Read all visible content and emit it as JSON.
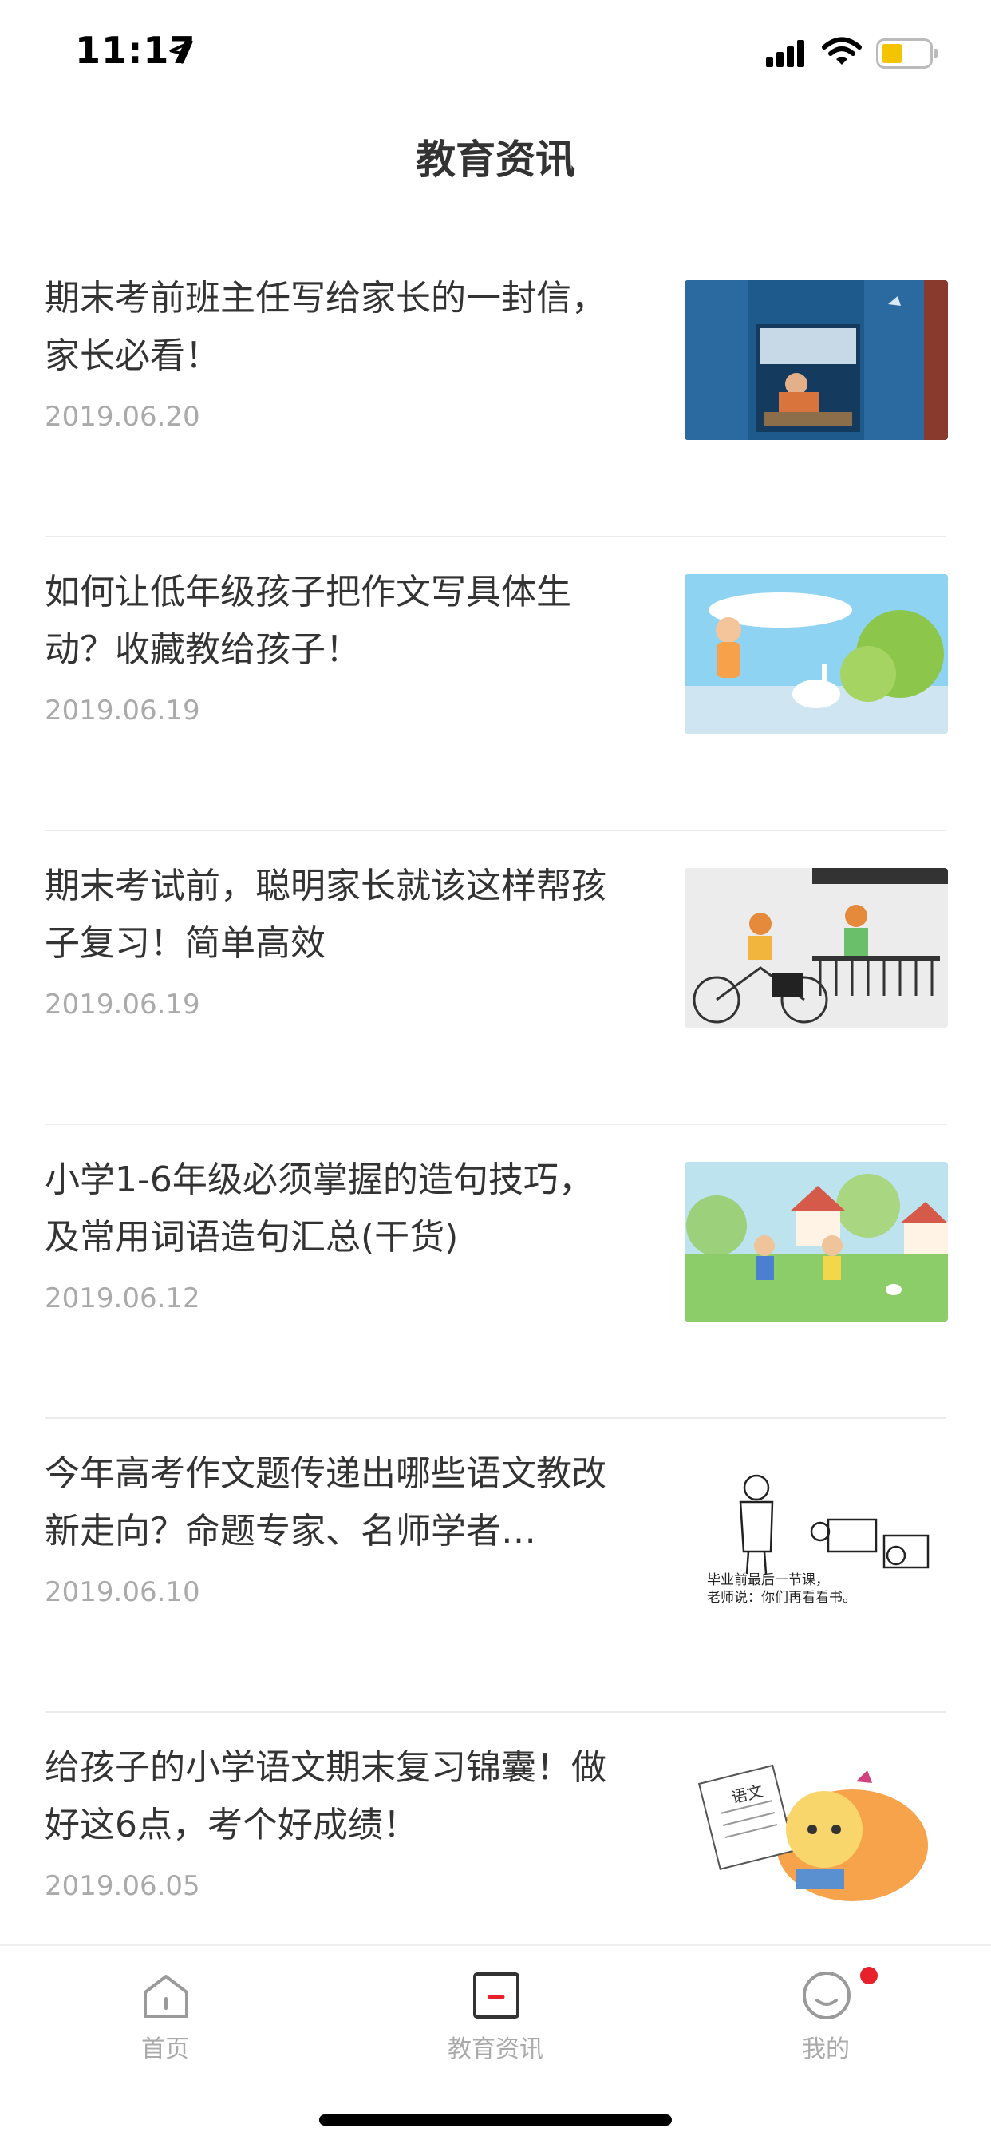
{
  "status_bar": {
    "time": "11:17",
    "icons": [
      "location-arrow-icon",
      "cellular-signal-icon",
      "wifi-icon",
      "battery-icon"
    ],
    "battery_color": "#f5c400"
  },
  "nav": {
    "title": "教育资讯"
  },
  "articles": [
    {
      "title": "期末考前班主任写给家长的一封信，家长必看！",
      "date": "2019.06.20",
      "thumbnail": "window-illustration"
    },
    {
      "title": "如何让低年级孩子把作文写具体生动？收藏教给孩子！",
      "date": "2019.06.19",
      "thumbnail": "girl-goose-illustration"
    },
    {
      "title": "期末考试前，聪明家长就该这样帮孩子复习！简单高效",
      "date": "2019.06.19",
      "thumbnail": "bicycle-boy-illustration"
    },
    {
      "title": "小学1-6年级必须掌握的造句技巧，及常用词语造句汇总(干货)",
      "date": "2019.06.12",
      "thumbnail": "children-playing-illustration"
    },
    {
      "title": "今年高考作文题传递出哪些语文教改新走向？命题专家、名师学者…",
      "date": "2019.06.10",
      "thumbnail": "teacher-sketch-illustration",
      "sketch_caption_1": "毕业前最后一节课，",
      "sketch_caption_2": "老师说：你们再看看书。"
    },
    {
      "title": "给孩子的小学语文期末复习锦囊！做好这6点，考个好成绩！",
      "date": "2019.06.05",
      "thumbnail": "girl-chinese-book-illustration",
      "book_label": "语文"
    }
  ],
  "tab_bar": {
    "tabs": [
      {
        "label": "首页",
        "icon": "home-icon",
        "active": false
      },
      {
        "label": "教育资讯",
        "icon": "news-icon",
        "active": true
      },
      {
        "label": "我的",
        "icon": "profile-smile-icon",
        "active": false,
        "has_badge": true
      }
    ],
    "accent_color": "#e8202a"
  }
}
